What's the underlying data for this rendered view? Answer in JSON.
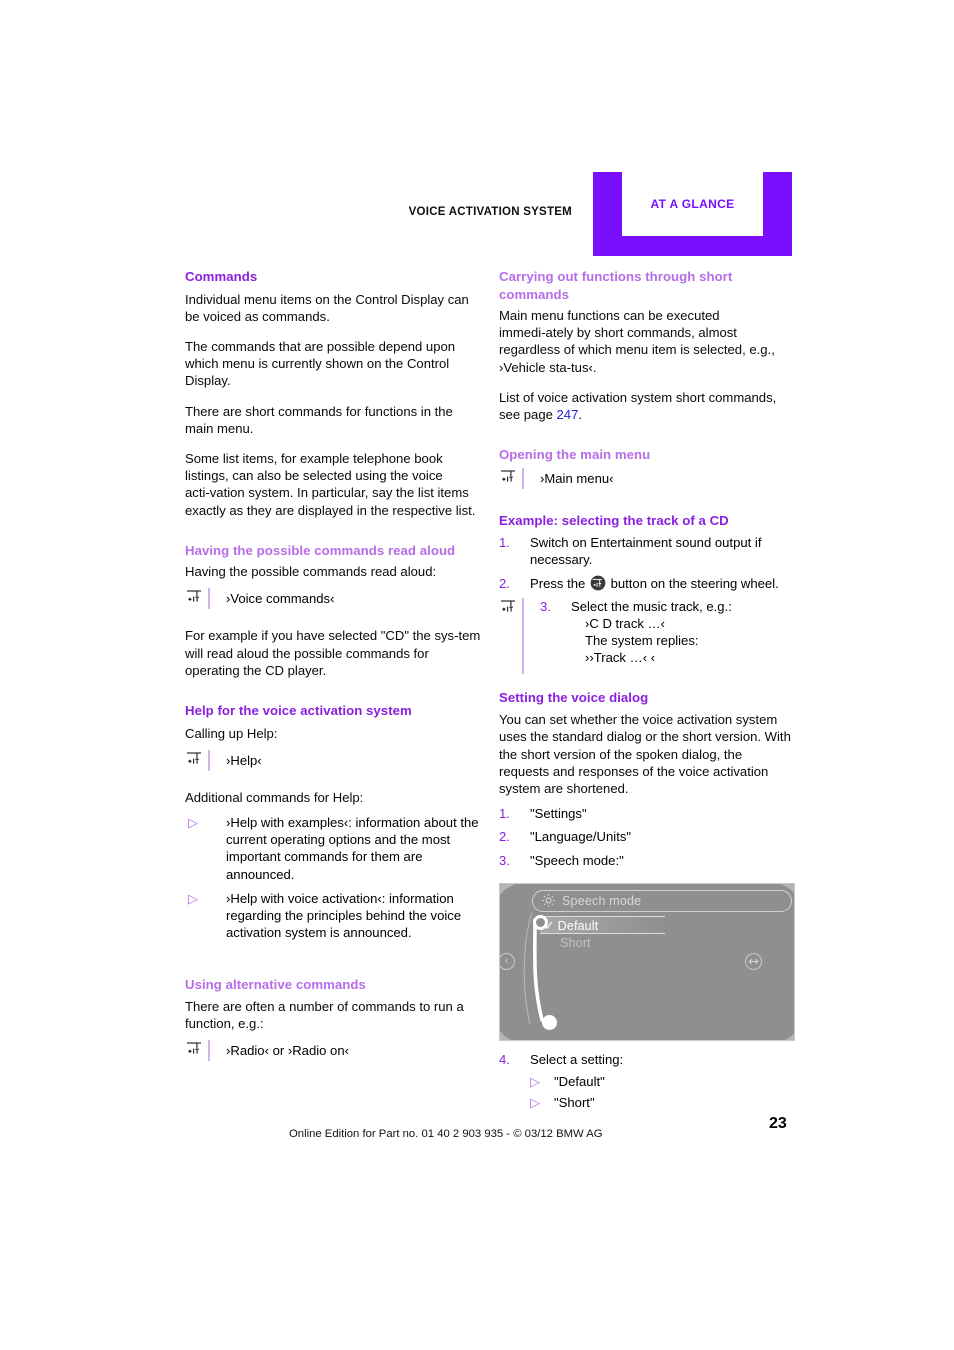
{
  "header": {
    "chapter": "VOICE ACTIVATION SYSTEM",
    "tab": "AT A GLANCE",
    "accent": "#7a0fff"
  },
  "colors": {
    "heading_strong": "#8a1fe0",
    "heading_light": "#b76de8",
    "link": "#2222dd",
    "tab_purple": "#7a0fff"
  },
  "left_column": {
    "commands": {
      "heading": "Commands",
      "paragraphs": [
        "Individual menu items on the Control Display can be voiced as commands.",
        "The commands that are possible depend upon which menu is currently shown on the Control Display.",
        "There are short commands for functions in the main menu.",
        "Some list items, for example telephone book listings, can also be selected using the voice acti‑vation system. In particular, say the list items exactly as they are displayed in the respective list."
      ]
    },
    "read_aloud": {
      "heading": "Having the possible commands read aloud",
      "intro": "Having the possible commands read aloud:",
      "command": "›Voice commands‹",
      "note": "For example if you have selected \"CD\" the sys‑tem will read aloud the possible commands for operating the CD player."
    },
    "help": {
      "heading": "Help for the voice activation system",
      "intro": "Calling up Help:",
      "command": "›Help‹",
      "additional_intro": "Additional commands for Help:",
      "bullets": [
        "›Help with examples‹: information about the current operating options and the most important commands for them are announced.",
        "›Help with voice activation‹: information regarding the principles behind the voice activation system is announced."
      ]
    },
    "alternative": {
      "heading": "Using alternative commands",
      "intro": "There are often a number of commands to run a function, e.g.:",
      "command": "›Radio‹  or ›Radio on‹"
    }
  },
  "right_column": {
    "short_commands": {
      "heading": "Carrying out functions through short commands",
      "paragraph": "Main menu functions can be executed immedi‑ately by short commands, almost regardless of which menu item is selected, e.g., ›Vehicle sta‑tus‹.",
      "reference_before": "List of voice activation system short commands, see page ",
      "reference_page": "247",
      "reference_after": "."
    },
    "main_menu": {
      "heading": "Opening the main menu",
      "command": "›Main menu‹"
    },
    "example_cd": {
      "heading": "Example: selecting the track of a CD",
      "step1_num": "1.",
      "step1": "Switch on Entertainment sound output if necessary.",
      "step2_num": "2.",
      "step2_before": "Press the ",
      "step2_after": " button on the steering wheel.",
      "step3_num": "3.",
      "step3": "Select the music track, e.g.:",
      "step3_line1": "›C D track …‹",
      "step3_line2": "The system replies:",
      "step3_line3": "››Track …‹ ‹"
    },
    "voice_dialog": {
      "heading": "Setting the voice dialog",
      "paragraph": "You can set whether the voice activation system uses the standard dialog or the short version. With the short version of the spoken dialog, the requests and responses of the voice activation system are shortened.",
      "steps": [
        {
          "num": "1.",
          "text": "\"Settings\""
        },
        {
          "num": "2.",
          "text": "\"Language/Units\""
        },
        {
          "num": "3.",
          "text": "\"Speech mode:\""
        }
      ],
      "step4_num": "4.",
      "step4": "Select a setting:",
      "step4_options": [
        "\"Default\"",
        "\"Short\""
      ]
    },
    "idrive": {
      "title": "Speech mode",
      "check": "✓",
      "selected_option": "Default",
      "other_option": "Short",
      "back_glyph": "‹"
    }
  },
  "footer": {
    "note": "Online Edition for Part no. 01 40 2 903 935 - © 03/12 BMW AG",
    "page": "23"
  }
}
